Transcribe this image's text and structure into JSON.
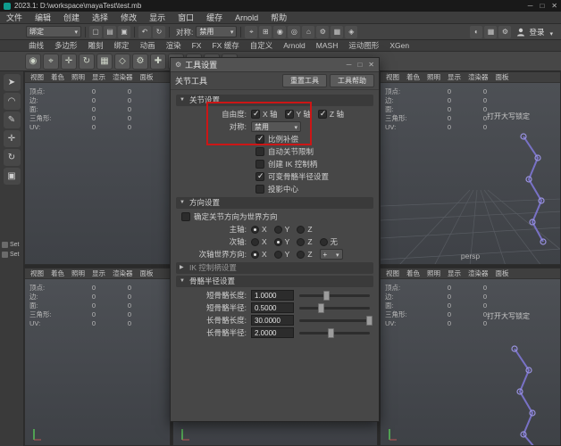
{
  "colors": {
    "highlight_red": "#cc1616",
    "joint_purple": "#7b74cc",
    "axis_green": "#57c057"
  },
  "titlebar": {
    "title": "2023.1: D:\\workspace\\mayaTest\\test.mb"
  },
  "menu_bar": {
    "items": [
      "文件",
      "编辑",
      "创建",
      "选择",
      "修改",
      "显示",
      "窗口",
      "缓存",
      "Arnold",
      "帮助"
    ]
  },
  "status_line": {
    "menuset": "绑定",
    "left_icons": [
      "▢",
      "▤",
      "▣"
    ],
    "history_icons": [
      "↶",
      "↻"
    ],
    "symmetry_label": "对称:",
    "symmetry_value": "禁用",
    "right_icons": [
      "⌖",
      "⊞",
      "◉",
      "◎",
      "⌂",
      "⚙",
      "▦",
      "◈"
    ],
    "far_right_icons": [
      "◐",
      "▦",
      "⚙"
    ],
    "signin_label": "登录"
  },
  "shelf": {
    "tabs": [
      "曲线",
      "多边形",
      "雕刻",
      "绑定",
      "动画",
      "渲染",
      "FX",
      "FX 缓存",
      "自定义",
      "Arnold",
      "MASH",
      "运动图形",
      "XGen"
    ],
    "icons": [
      "◉",
      "⌖",
      "✛",
      "↻",
      "▦",
      "◇",
      "⚙",
      "✚",
      "○",
      "◆",
      "▤",
      "✓"
    ]
  },
  "toolbox": {
    "tools": [
      "➤",
      "◠",
      "✎",
      "✛",
      "↻",
      "▣"
    ],
    "set_items": [
      "Set",
      "Set"
    ]
  },
  "viewport": {
    "menu_items": [
      "视图",
      "着色",
      "照明",
      "显示",
      "渲染器",
      "面板"
    ],
    "hud_rows": [
      {
        "label": "顶点:",
        "v1": "0",
        "v2": "0"
      },
      {
        "label": "边:",
        "v1": "0",
        "v2": "0"
      },
      {
        "label": "面:",
        "v1": "0",
        "v2": "0"
      },
      {
        "label": "三角形:",
        "v1": "0",
        "v2": "0"
      },
      {
        "label": "UV:",
        "v1": "0",
        "v2": "0"
      }
    ],
    "capslock_warning": "打开大写锁定",
    "camera_label": "persp"
  },
  "tool_settings": {
    "title": "工具设置",
    "tool_name": "关节工具",
    "reset_label": "重置工具",
    "help_label": "工具帮助",
    "joint_section": {
      "title": "关节设置",
      "dof_label": "自由度:",
      "dof_options": [
        {
          "label": "X 轴",
          "checked": true
        },
        {
          "label": "Y 轴",
          "checked": true
        },
        {
          "label": "Z 轴",
          "checked": true
        }
      ],
      "symmetry_label": "对称:",
      "symmetry_value": "禁用",
      "checkbox_rows": [
        {
          "label": "比例补偿",
          "checked": true
        },
        {
          "label": "自动关节限制",
          "checked": false
        },
        {
          "label": "创建 IK 控制柄",
          "checked": false
        },
        {
          "label": "可变骨骼半径设置",
          "checked": true
        },
        {
          "label": "投影中心",
          "checked": false
        }
      ]
    },
    "orient_section": {
      "title": "方向设置",
      "world_checkbox": {
        "label": "确定关节方向为世界方向",
        "checked": false
      },
      "primary_label": "主轴:",
      "primary_options": [
        {
          "label": "X",
          "selected": true
        },
        {
          "label": "Y",
          "selected": false
        },
        {
          "label": "Z",
          "selected": false
        }
      ],
      "secondary_label": "次轴:",
      "secondary_options": [
        {
          "label": "X",
          "selected": false
        },
        {
          "label": "Y",
          "selected": true
        },
        {
          "label": "Z",
          "selected": false
        },
        {
          "label": "无",
          "selected": false
        }
      ],
      "sao_label": "次轴世界方向:",
      "sao_options": [
        {
          "label": "X",
          "selected": true
        },
        {
          "label": "Y",
          "selected": false
        },
        {
          "label": "Z",
          "selected": false
        }
      ],
      "sao_sign": "+"
    },
    "ik_section": {
      "title": "IK 控制柄设置"
    },
    "radius_section": {
      "title": "骨骼半径设置",
      "rows": [
        {
          "label": "短骨骼长度:",
          "value": "1.0000",
          "pos": 34
        },
        {
          "label": "短骨骼半径:",
          "value": "0.5000",
          "pos": 26
        },
        {
          "label": "长骨骼长度:",
          "value": "30.0000",
          "pos": 95
        },
        {
          "label": "长骨骼半径:",
          "value": "2.0000",
          "pos": 40
        }
      ]
    }
  }
}
